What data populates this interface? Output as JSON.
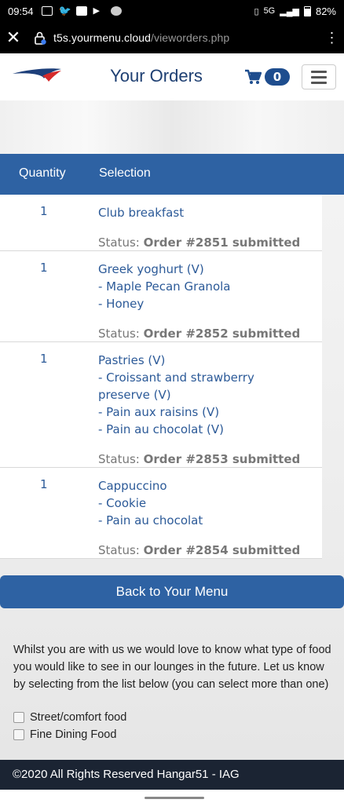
{
  "status_bar": {
    "time": "09:54",
    "network": "5G",
    "battery": "82%"
  },
  "browser": {
    "host": "t5s.yourmenu.cloud",
    "path": "/vieworders.php",
    "close_icon": "close-icon",
    "more_icon": "more-vert-icon"
  },
  "header": {
    "title": "Your Orders",
    "cart_count": "0"
  },
  "table": {
    "headers": {
      "quantity": "Quantity",
      "selection": "Selection"
    },
    "rows": [
      {
        "qty": "1",
        "items": [
          "Club breakfast"
        ],
        "status_label": "Status:",
        "status_value": "Order #2851 submitted"
      },
      {
        "qty": "1",
        "items": [
          "Greek yoghurt (V)",
          "- Maple Pecan Granola",
          "- Honey"
        ],
        "status_label": "Status:",
        "status_value": "Order #2852 submitted"
      },
      {
        "qty": "1",
        "items": [
          "Pastries (V)",
          "- Croissant and strawberry preserve (V)",
          "- Pain aux raisins (V)",
          "- Pain au chocolat (V)"
        ],
        "status_label": "Status:",
        "status_value": "Order #2853 submitted"
      },
      {
        "qty": "1",
        "items": [
          "Cappuccino",
          "- Cookie",
          "- Pain au chocolat"
        ],
        "status_label": "Status:",
        "status_value": "Order #2854 submitted"
      }
    ]
  },
  "back_button": "Back to Your Menu",
  "survey": {
    "text": "Whilst you are with us we would love to know what type of food you would like to see in our lounges in the future. Let us know by selecting from the list below (you can select more than one)",
    "options": [
      "Street/comfort food",
      "Fine Dining Food"
    ]
  },
  "footer": "©2020 All Rights Reserved Hangar51 - IAG",
  "colors": {
    "primary": "#2e62a3",
    "footer": "#1b2433",
    "link_text": "#2c5a98"
  }
}
